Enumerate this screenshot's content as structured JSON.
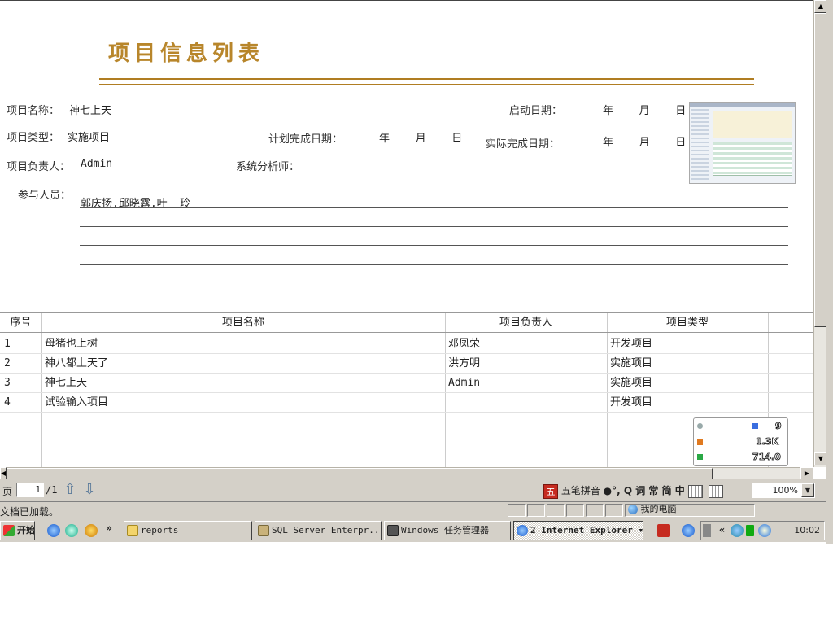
{
  "report": {
    "title": "项目信息列表",
    "fields": {
      "project_name_label": "项目名称：",
      "project_name_value": "神七上天",
      "start_date_label": "启动日期：",
      "start_date_value": "年  月  日",
      "project_type_label": "项目类型：",
      "project_type_value": "实施项目",
      "planned_date_label": "计划完成日期：",
      "planned_date_value": "年  月  日",
      "actual_date_label": "实际完成日期：",
      "actual_date_value": "年  月  日",
      "manager_label": "项目负责人：",
      "manager_value": "Admin",
      "analyst_label": "系统分析师：",
      "analyst_value": "",
      "participants_label": "参与人员：",
      "participants_value": "郭庆扬,邱晓露,叶  玲"
    }
  },
  "table": {
    "headers": [
      "序号",
      "项目名称",
      "项目负责人",
      "项目类型"
    ],
    "rows": [
      {
        "no": "1",
        "name": "母猪也上树",
        "manager": "邓凤荣",
        "type": "开发项目"
      },
      {
        "no": "2",
        "name": "神八都上天了",
        "manager": "洪方明",
        "type": "实施项目"
      },
      {
        "no": "3",
        "name": "神七上天",
        "manager": "Admin",
        "type": "实施项目"
      },
      {
        "no": "4",
        "name": "试验输入项目",
        "manager": "",
        "type": "开发项目"
      }
    ]
  },
  "net_widget": {
    "count": "9",
    "up": "1.3K",
    "down": "714.0"
  },
  "toolbar": {
    "page_label": "页",
    "page_value": "1",
    "page_total": "/1",
    "ime_text": "五笔拼音",
    "ime_tools": "●°, Q 词 常 简 中",
    "zoom": "100%"
  },
  "status": {
    "text": "文档已加载。",
    "zone": "我的电脑"
  },
  "taskbar": {
    "start": "开始",
    "chevron": "»",
    "buttons": [
      {
        "label": "reports"
      },
      {
        "label": "SQL Server Enterpr..."
      },
      {
        "label": "Windows 任务管理器"
      },
      {
        "label": "2 Internet Explorer"
      }
    ],
    "clock": "10:02"
  },
  "colors": {
    "title": "#b8862b",
    "rule": "#b07d22",
    "chrome": "#d4d0c8"
  }
}
